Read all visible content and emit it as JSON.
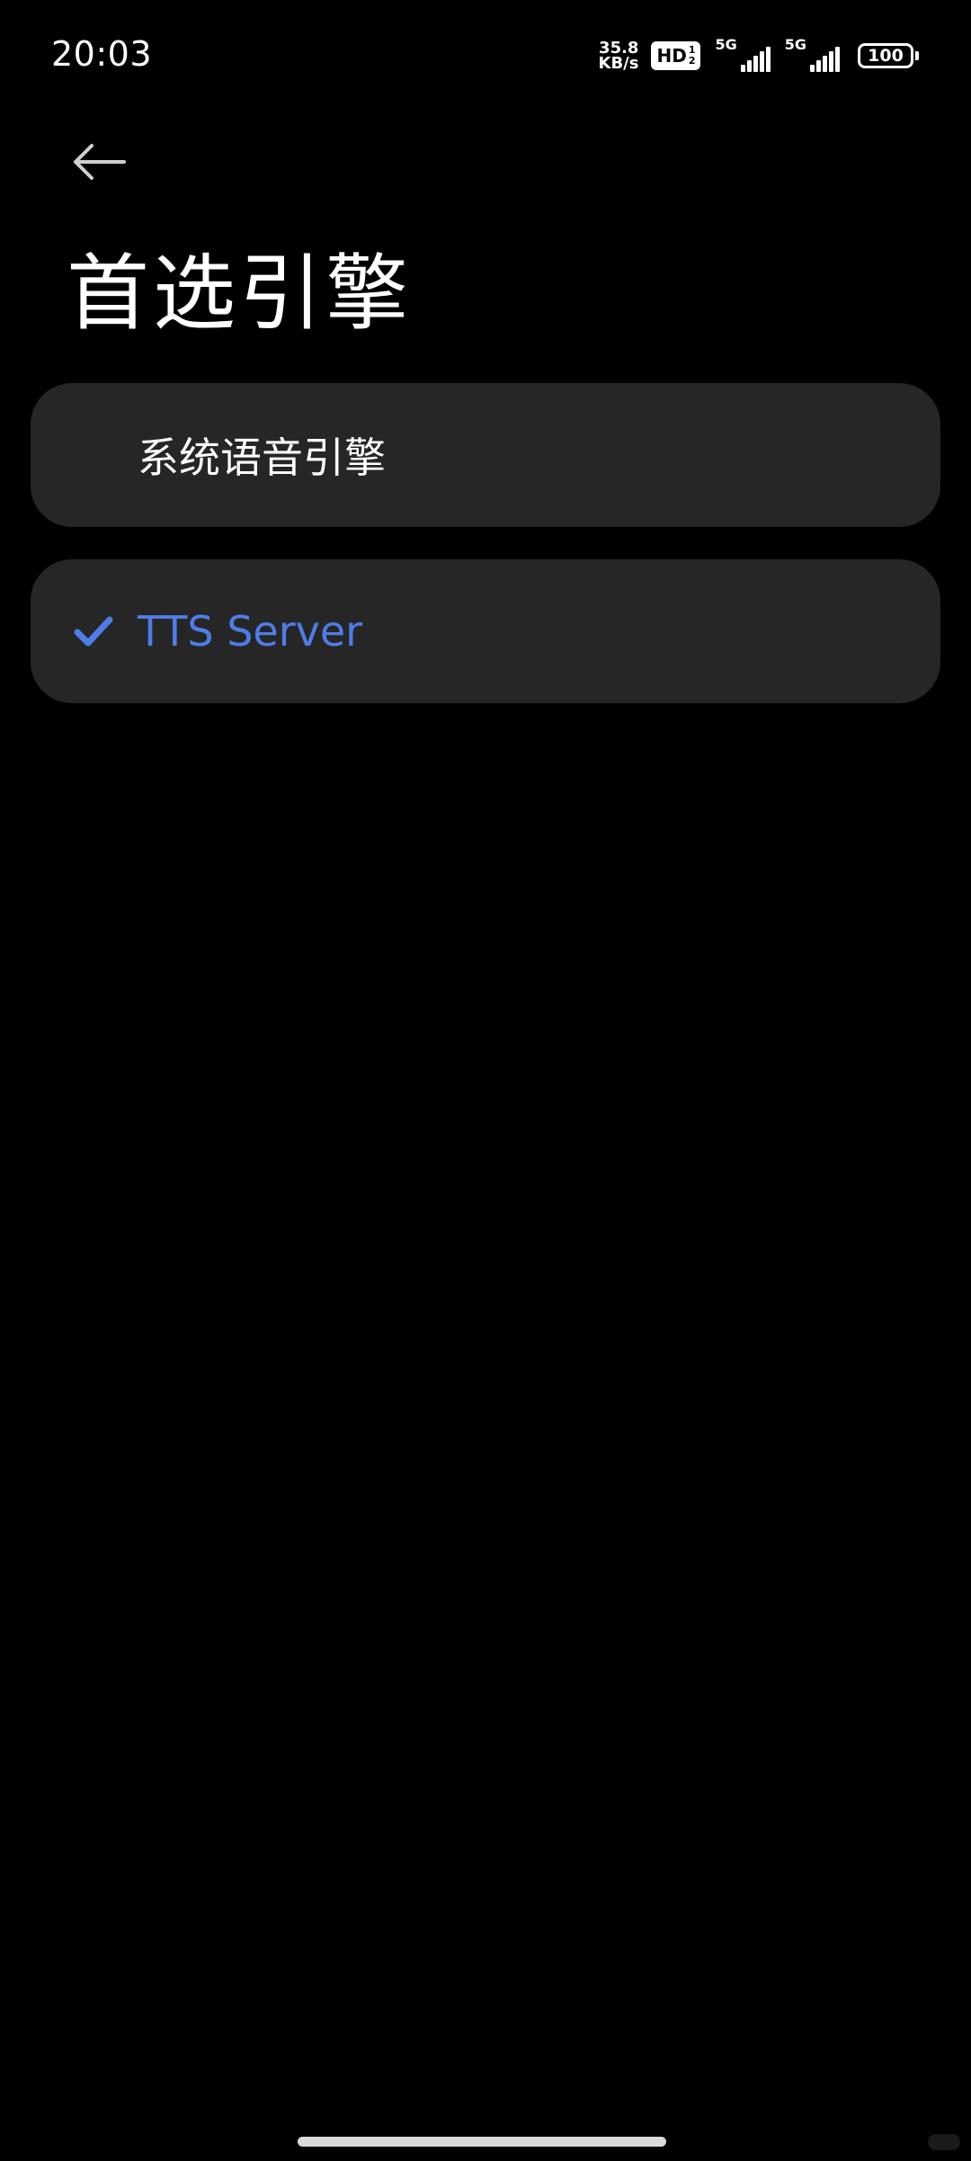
{
  "status_bar": {
    "time": "20:03",
    "net_speed_value": "35.8",
    "net_speed_unit": "KB/s",
    "hd_label": "HD",
    "hd_sub_top": "1",
    "hd_sub_bottom": "2",
    "sim1_tag": "5G",
    "sim2_tag": "5G",
    "battery": "100"
  },
  "header": {
    "back_icon": "arrow-left-icon",
    "title": "首选引擎"
  },
  "options": [
    {
      "label": "系统语音引擎",
      "selected": false
    },
    {
      "label": "TTS Server",
      "selected": true
    }
  ],
  "colors": {
    "background": "#000000",
    "card": "#262626",
    "accent": "#4f7ce8",
    "text": "#ffffff"
  }
}
